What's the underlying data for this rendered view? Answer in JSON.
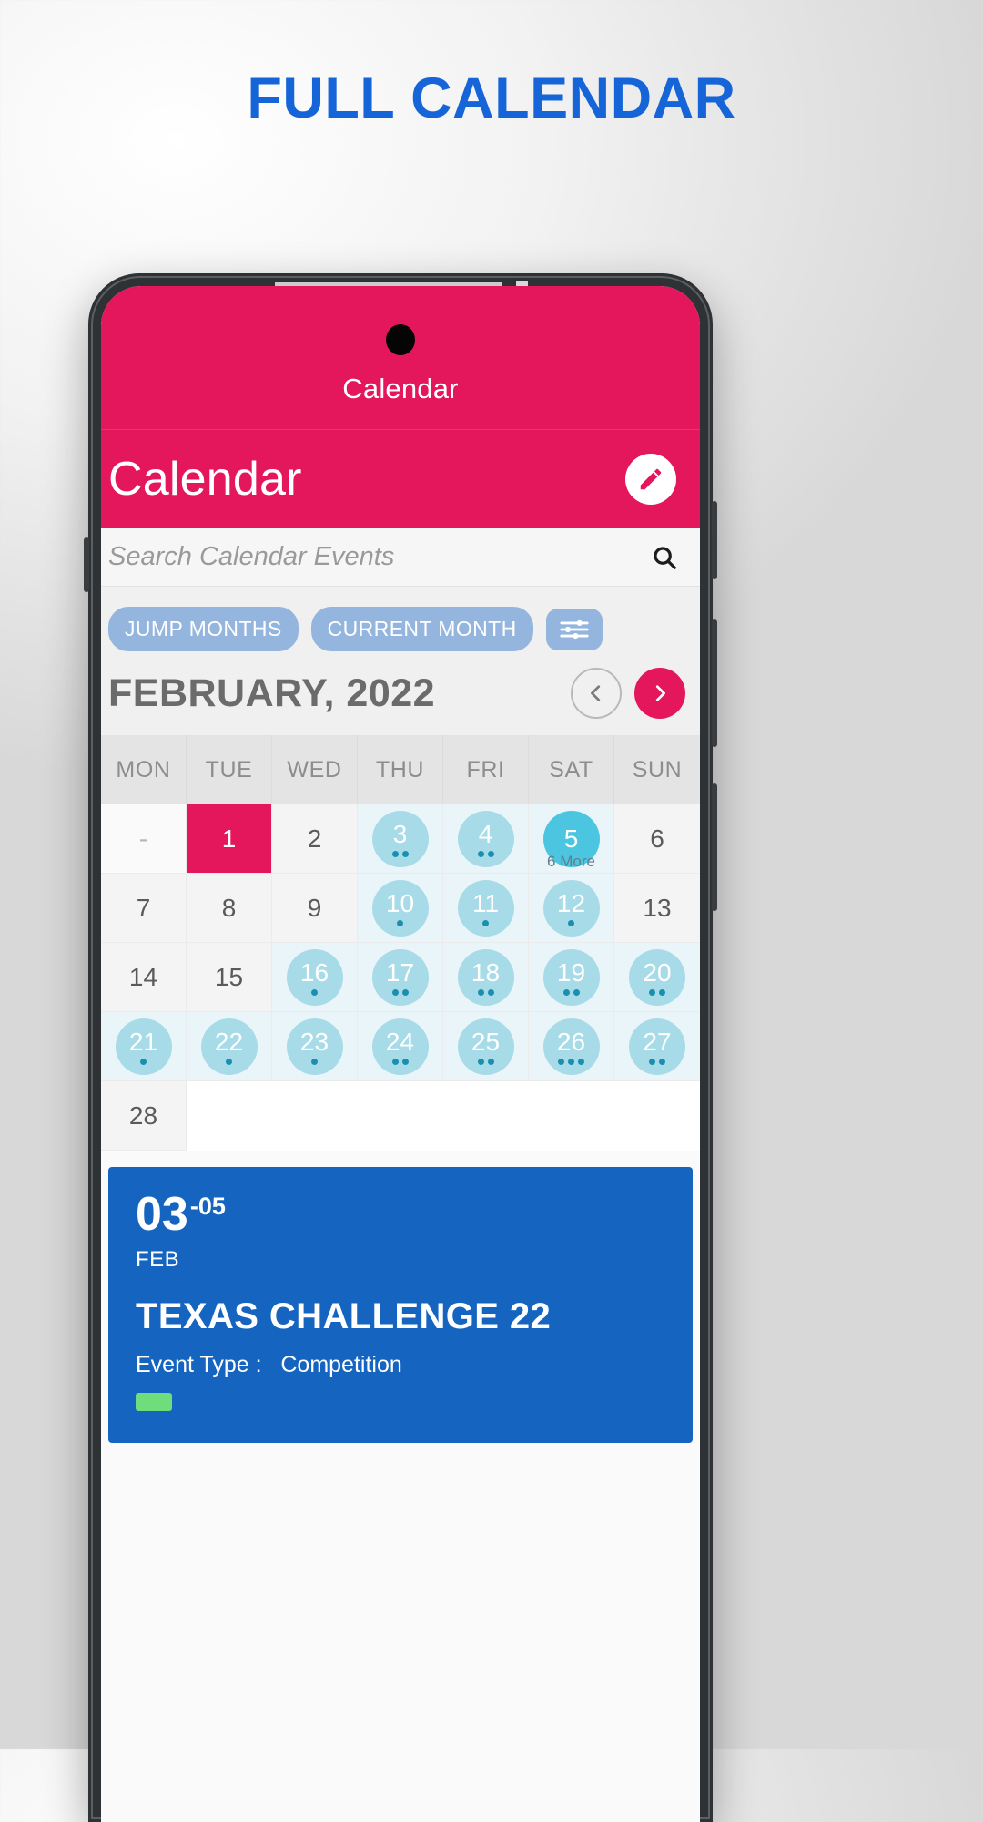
{
  "promo": {
    "headline": "FULL CALENDAR",
    "headline_color": "#1565d8"
  },
  "theme": {
    "primary": "#e5175c",
    "chip": "#93b5de",
    "event_circle": "#a8dbe8",
    "event_circle_today": "#4cc5e0",
    "event_card": "#1565c0",
    "badge": "#6fdd7c"
  },
  "statusbar": {
    "title": "Calendar"
  },
  "titlebar": {
    "title": "Calendar",
    "edit_icon": "pencil-icon"
  },
  "search": {
    "placeholder": "Search Calendar Events",
    "value": "",
    "icon": "search-icon"
  },
  "chips": [
    {
      "label": "JUMP MONTHS"
    },
    {
      "label": "CURRENT MONTH"
    }
  ],
  "filter_button": {
    "icon": "sliders-icon"
  },
  "month": {
    "title": "FEBRUARY, 2022",
    "prev_icon": "chevron-left-icon",
    "next_icon": "chevron-right-icon"
  },
  "weekdays": [
    "MON",
    "TUE",
    "WED",
    "THU",
    "FRI",
    "SAT",
    "SUN"
  ],
  "days": [
    {
      "label": "-",
      "state": "empty",
      "dots": 0
    },
    {
      "label": "1",
      "state": "selected",
      "dots": 0
    },
    {
      "label": "2",
      "state": "plain",
      "dots": 0
    },
    {
      "label": "3",
      "state": "event",
      "dots": 2
    },
    {
      "label": "4",
      "state": "event",
      "dots": 2
    },
    {
      "label": "5",
      "state": "today",
      "dots": 0,
      "more": "6 More"
    },
    {
      "label": "6",
      "state": "plain",
      "dots": 0
    },
    {
      "label": "7",
      "state": "plain",
      "dots": 0
    },
    {
      "label": "8",
      "state": "plain",
      "dots": 0
    },
    {
      "label": "9",
      "state": "plain",
      "dots": 0
    },
    {
      "label": "10",
      "state": "event",
      "dots": 1
    },
    {
      "label": "11",
      "state": "event",
      "dots": 1
    },
    {
      "label": "12",
      "state": "event",
      "dots": 1
    },
    {
      "label": "13",
      "state": "plain",
      "dots": 0
    },
    {
      "label": "14",
      "state": "plain",
      "dots": 0
    },
    {
      "label": "15",
      "state": "plain",
      "dots": 0
    },
    {
      "label": "16",
      "state": "event",
      "dots": 1
    },
    {
      "label": "17",
      "state": "event",
      "dots": 2
    },
    {
      "label": "18",
      "state": "event",
      "dots": 2
    },
    {
      "label": "19",
      "state": "event",
      "dots": 2
    },
    {
      "label": "20",
      "state": "event",
      "dots": 2
    },
    {
      "label": "21",
      "state": "event",
      "dots": 1
    },
    {
      "label": "22",
      "state": "event",
      "dots": 1
    },
    {
      "label": "23",
      "state": "event",
      "dots": 1
    },
    {
      "label": "24",
      "state": "event",
      "dots": 2
    },
    {
      "label": "25",
      "state": "event",
      "dots": 2
    },
    {
      "label": "26",
      "state": "event",
      "dots": 3
    },
    {
      "label": "27",
      "state": "event",
      "dots": 2
    },
    {
      "label": "28",
      "state": "plain",
      "dots": 0
    },
    {
      "label": "",
      "state": "blank",
      "dots": 0
    },
    {
      "label": "",
      "state": "blank",
      "dots": 0
    },
    {
      "label": "",
      "state": "blank",
      "dots": 0
    },
    {
      "label": "",
      "state": "blank",
      "dots": 0
    },
    {
      "label": "",
      "state": "blank",
      "dots": 0
    },
    {
      "label": "",
      "state": "blank",
      "dots": 0
    }
  ],
  "event_card": {
    "day_start": "03",
    "day_end": "-05",
    "month": "FEB",
    "title": "TEXAS CHALLENGE 22",
    "type_label": "Event Type :",
    "type_value": "Competition",
    "badge": ""
  }
}
